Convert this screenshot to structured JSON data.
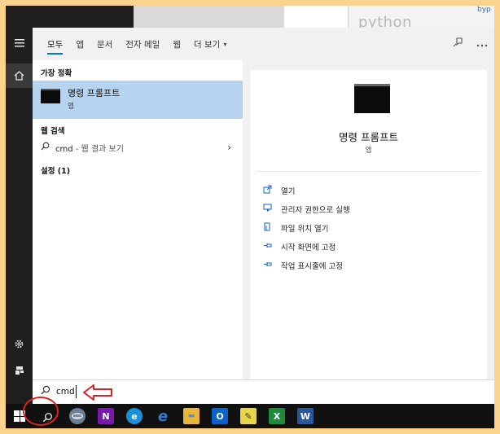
{
  "background": {
    "python_text": "python",
    "byp_text": "byp"
  },
  "rail": {
    "menu_icon": "hamburger-menu-icon",
    "home_icon": "home-icon",
    "settings_icon": "gear-icon",
    "user_icon": "user-icon"
  },
  "tabs": [
    {
      "label": "모두",
      "active": true
    },
    {
      "label": "앱"
    },
    {
      "label": "문서"
    },
    {
      "label": "전자 메일"
    },
    {
      "label": "웹"
    },
    {
      "label": "더 보기"
    }
  ],
  "tab_more_caret": "▾",
  "best_match": {
    "section_label": "가장 정확",
    "title": "명령 프롬프트",
    "subtitle": "앱"
  },
  "web_search": {
    "section_label": "웹 검색",
    "query": "cmd",
    "suffix": " - 웹 결과 보기",
    "chevron": "›"
  },
  "settings_section": {
    "label": "설정 (1)"
  },
  "preview": {
    "title": "명령 프롬프트",
    "subtitle": "앱",
    "actions": [
      {
        "label": "열기",
        "icon": "open-icon"
      },
      {
        "label": "관리자 권한으로 실행",
        "icon": "admin-shield-icon"
      },
      {
        "label": "파일 위치 열기",
        "icon": "file-location-icon"
      },
      {
        "label": "시작 화면에 고정",
        "icon": "pin-icon"
      },
      {
        "label": "작업 표시줄에 고정",
        "icon": "pin-icon"
      }
    ]
  },
  "search_box": {
    "value": "cmd"
  },
  "taskbar": {
    "apps": [
      {
        "name": "onenote",
        "glyph": "N",
        "color": "#7719aa"
      },
      {
        "name": "edge",
        "glyph": "e",
        "color": "#1a8fdc"
      },
      {
        "name": "ie",
        "glyph": "e",
        "color": "#2a7fd6"
      },
      {
        "name": "explorer",
        "glyph": "▬",
        "color": "#e8b63a"
      },
      {
        "name": "outlook",
        "glyph": "O",
        "color": "#0a64c8"
      },
      {
        "name": "sticky",
        "glyph": "✎",
        "color": "#e8d64a"
      },
      {
        "name": "excel",
        "glyph": "X",
        "color": "#1d8a3c"
      },
      {
        "name": "word",
        "glyph": "W",
        "color": "#2b579a"
      }
    ]
  },
  "colors": {
    "frame": "#fbd38d",
    "accent": "#0078d7",
    "highlight": "#b6d4ef",
    "annotation_red": "#e02020"
  }
}
